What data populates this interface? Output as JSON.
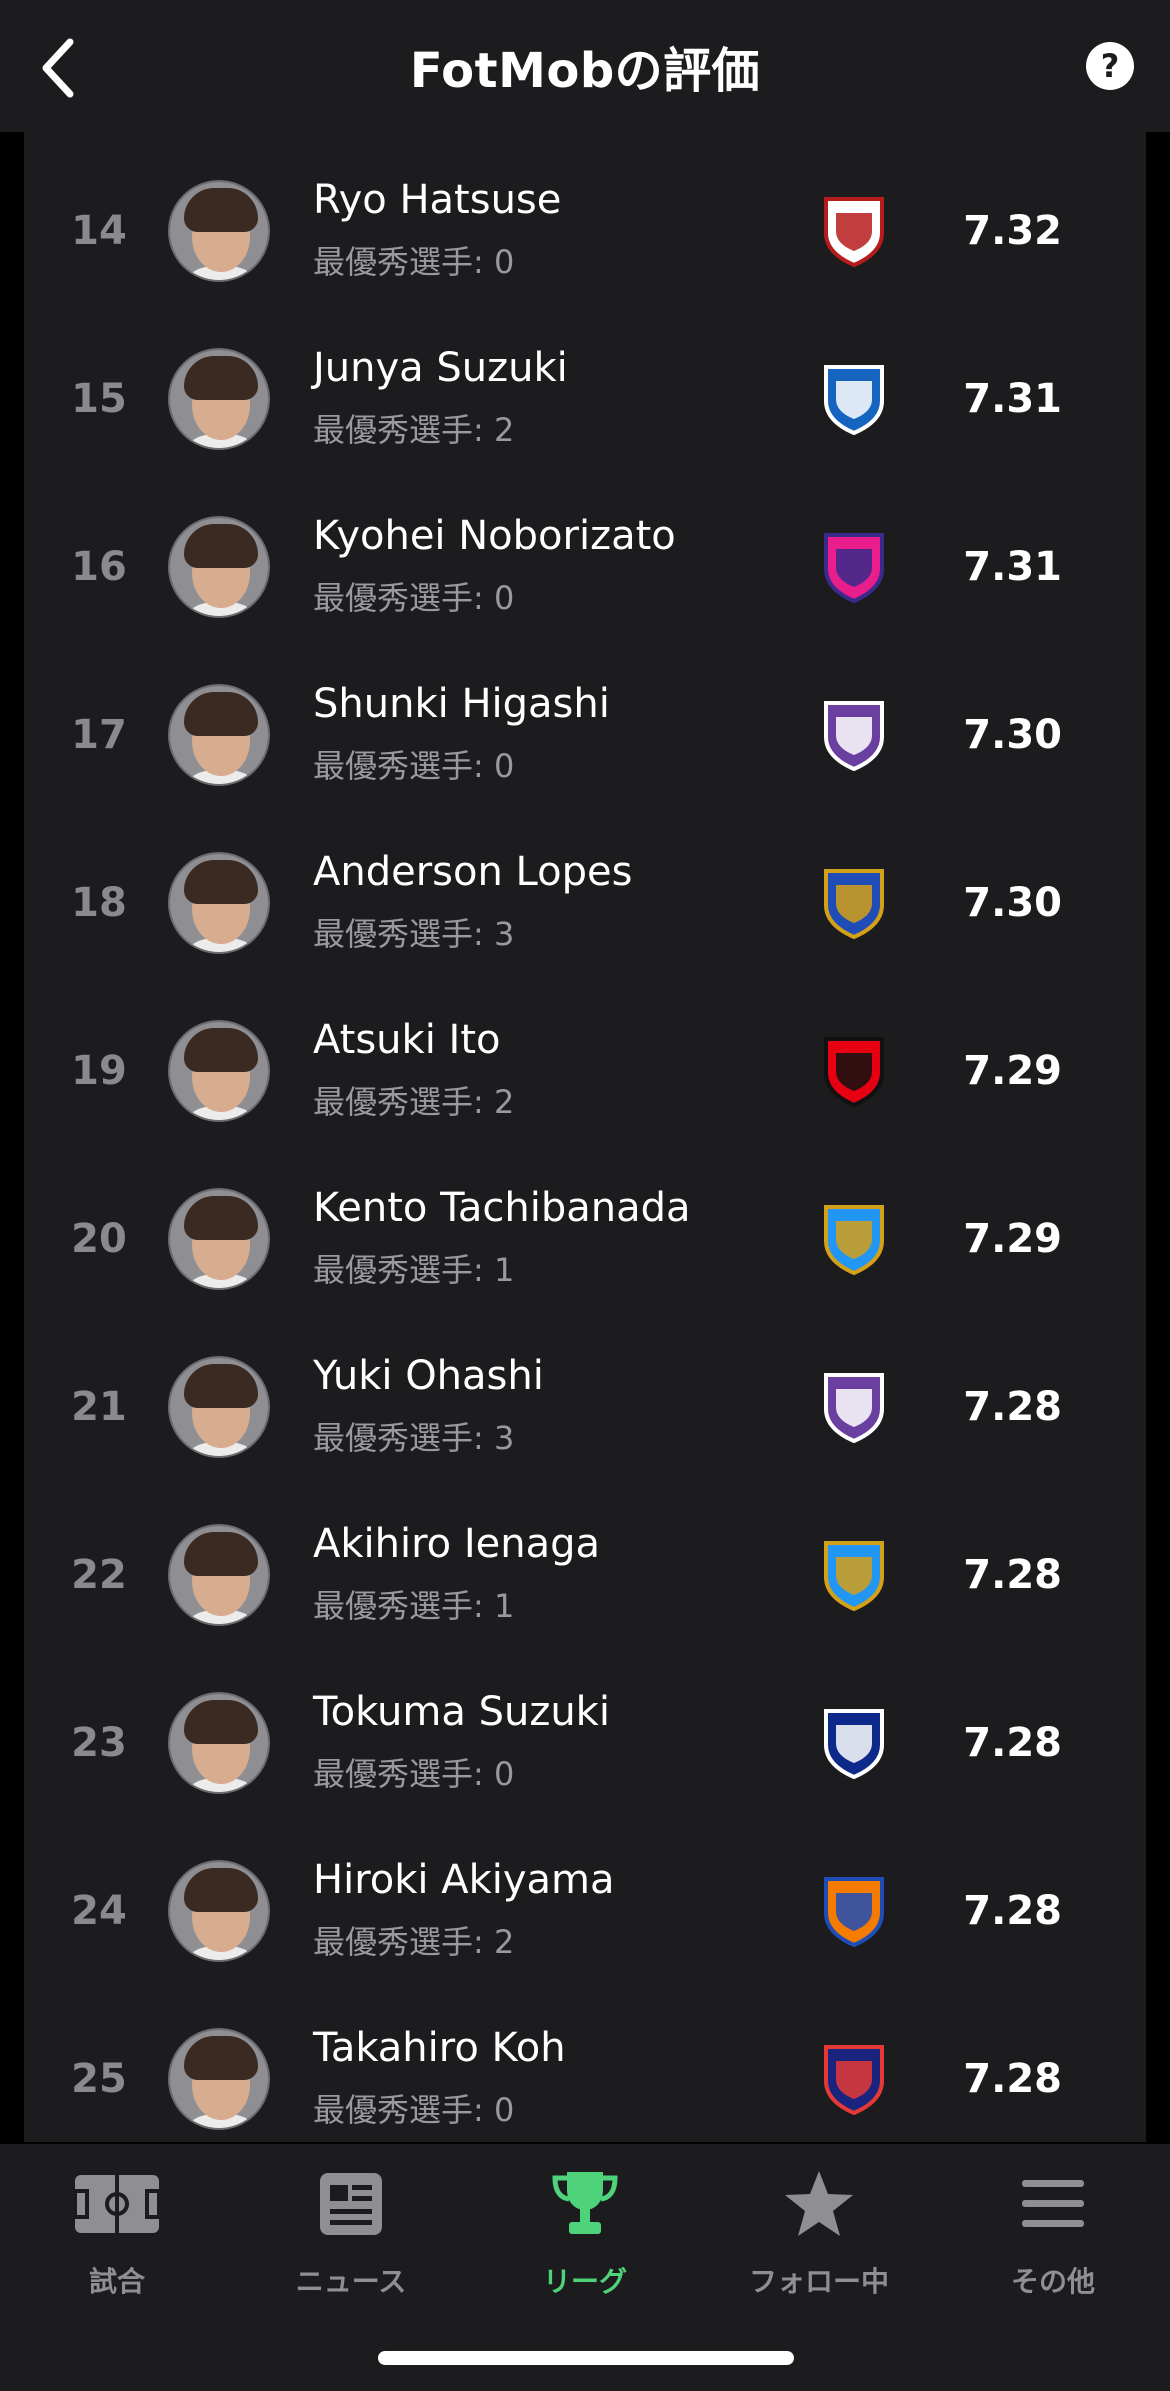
{
  "header": {
    "title": "FotMobの評価",
    "help_label": "?"
  },
  "players": [
    {
      "rank": "14",
      "name": "Ryo Hatsuse",
      "motm": "最優秀選手: 0",
      "rating": "7.32",
      "club_colors": [
        "#ffffff",
        "#b71c1c"
      ]
    },
    {
      "rank": "15",
      "name": "Junya Suzuki",
      "motm": "最優秀選手: 2",
      "rating": "7.31",
      "club_colors": [
        "#1565c0",
        "#ffffff"
      ]
    },
    {
      "rank": "16",
      "name": "Kyohei Noborizato",
      "motm": "最優秀選手: 0",
      "rating": "7.31",
      "club_colors": [
        "#e91e8c",
        "#3a2a8a"
      ]
    },
    {
      "rank": "17",
      "name": "Shunki Higashi",
      "motm": "最優秀選手: 0",
      "rating": "7.30",
      "club_colors": [
        "#6a3fa0",
        "#ffffff"
      ]
    },
    {
      "rank": "18",
      "name": "Anderson Lopes",
      "motm": "最優秀選手: 3",
      "rating": "7.30",
      "club_colors": [
        "#1e4db7",
        "#d4a017"
      ]
    },
    {
      "rank": "19",
      "name": "Atsuki Ito",
      "motm": "最優秀選手: 2",
      "rating": "7.29",
      "club_colors": [
        "#e60012",
        "#111111"
      ]
    },
    {
      "rank": "20",
      "name": "Kento Tachibanada",
      "motm": "最優秀選手: 1",
      "rating": "7.29",
      "club_colors": [
        "#2196f3",
        "#d4a017"
      ]
    },
    {
      "rank": "21",
      "name": "Yuki Ohashi",
      "motm": "最優秀選手: 3",
      "rating": "7.28",
      "club_colors": [
        "#6a3fa0",
        "#ffffff"
      ]
    },
    {
      "rank": "22",
      "name": "Akihiro Ienaga",
      "motm": "最優秀選手: 1",
      "rating": "7.28",
      "club_colors": [
        "#2196f3",
        "#d4a017"
      ]
    },
    {
      "rank": "23",
      "name": "Tokuma Suzuki",
      "motm": "最優秀選手: 0",
      "rating": "7.28",
      "club_colors": [
        "#0d2a8a",
        "#ffffff"
      ]
    },
    {
      "rank": "24",
      "name": "Hiroki Akiyama",
      "motm": "最優秀選手: 2",
      "rating": "7.28",
      "club_colors": [
        "#f57c00",
        "#1e4db7"
      ]
    },
    {
      "rank": "25",
      "name": "Takahiro Koh",
      "motm": "最優秀選手: 0",
      "rating": "7.28",
      "club_colors": [
        "#1a237e",
        "#e53935"
      ]
    }
  ],
  "tabs": [
    {
      "label": "試合",
      "icon": "pitch-icon",
      "active": false
    },
    {
      "label": "ニュース",
      "icon": "news-icon",
      "active": false
    },
    {
      "label": "リーグ",
      "icon": "trophy-icon",
      "active": true
    },
    {
      "label": "フォロー中",
      "icon": "star-icon",
      "active": false
    },
    {
      "label": "その他",
      "icon": "menu-icon",
      "active": false
    }
  ],
  "colors": {
    "accent": "#4ed37a",
    "inactive": "#8e8e93",
    "surface": "#1c1c1e"
  }
}
